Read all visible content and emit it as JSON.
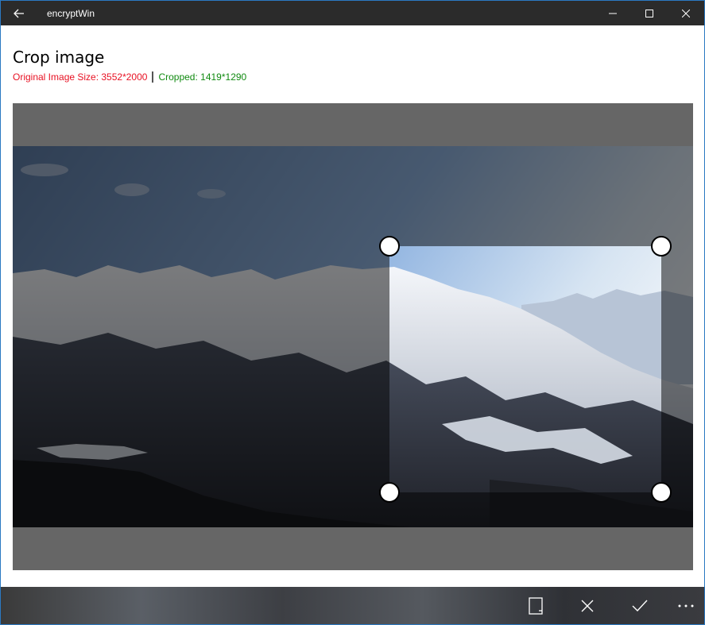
{
  "window": {
    "app_title": "encryptWin"
  },
  "page": {
    "title": "Crop image",
    "original_size": "Original Image Size: 3552*2000",
    "cropped_size": "Cropped: 1419*1290"
  },
  "colors": {
    "original_size_text": "#e81123",
    "cropped_size_text": "#108a10",
    "canvas_bg": "#666666",
    "titlebar_bg": "#2b2b2b"
  },
  "icons": {
    "back": "back-arrow-icon",
    "minimize": "minimize-icon",
    "maximize": "maximize-icon",
    "close": "close-icon",
    "aspect": "aspect-ratio-icon",
    "cancel": "cancel-icon",
    "accept": "checkmark-icon",
    "more": "more-icon"
  }
}
